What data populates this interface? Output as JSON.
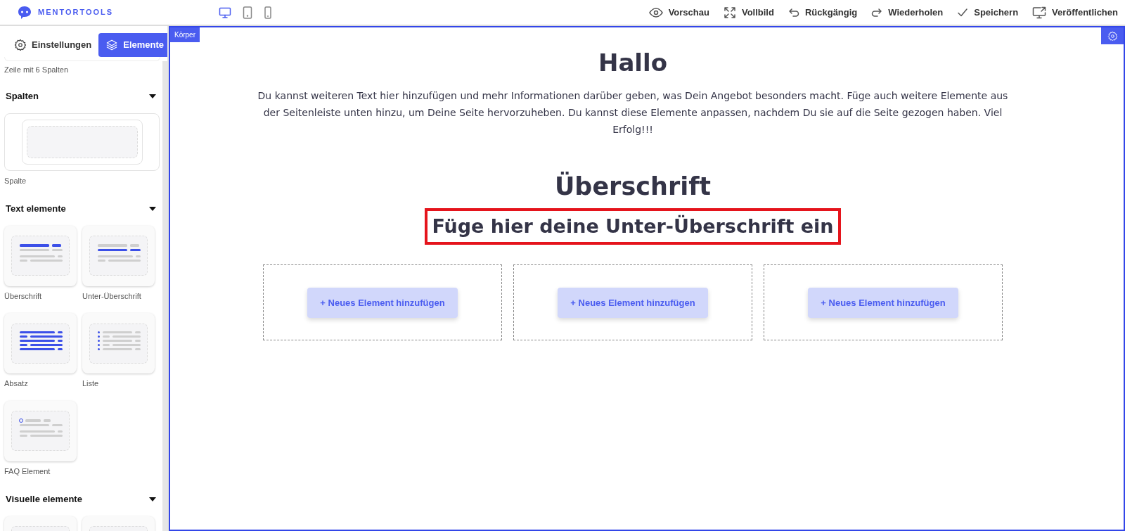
{
  "logo": {
    "text": "MENTORTOOLS"
  },
  "devices": [
    {
      "kind": "desktop",
      "selected": true
    },
    {
      "kind": "tablet",
      "selected": false
    },
    {
      "kind": "phone",
      "selected": false
    }
  ],
  "actions": [
    {
      "kind": "eye",
      "label": "Vorschau"
    },
    {
      "kind": "expand",
      "label": "Vollbild"
    },
    {
      "kind": "undo",
      "label": "Rückgängig"
    },
    {
      "kind": "redo",
      "label": "Wiederholen"
    },
    {
      "kind": "check",
      "label": "Speichern"
    },
    {
      "kind": "monitor",
      "label": "Veröffentlichen"
    }
  ],
  "sidebar": {
    "tabs": [
      {
        "kind": "gear",
        "label": "Einstellungen",
        "selected": false
      },
      {
        "kind": "layers",
        "label": "Elemente",
        "selected": true
      }
    ],
    "cut_item_label": "Zeile mit 6 Spalten",
    "sections": [
      {
        "title": "Spalten",
        "expanded": true,
        "items": [
          {
            "kind": "column",
            "label": "Spalte"
          }
        ]
      },
      {
        "title": "Text elemente",
        "expanded": true,
        "items": [
          {
            "kind": "heading",
            "label": "Überschrift"
          },
          {
            "kind": "subheading",
            "label": "Unter-Überschrift"
          },
          {
            "kind": "paragraph",
            "label": "Absatz"
          },
          {
            "kind": "list",
            "label": "Liste"
          },
          {
            "kind": "faq",
            "label": "FAQ Element"
          }
        ]
      },
      {
        "title": "Visuelle elemente",
        "expanded": true,
        "items": [
          {
            "kind": "blank"
          },
          {
            "kind": "blank"
          }
        ]
      }
    ]
  },
  "canvas": {
    "body_tag": "Körper",
    "title": "Hallo",
    "paragraph": "Du kannst weiteren Text hier hinzufügen und mehr Informationen darüber geben, was Dein Angebot besonders macht. Füge auch weitere Elemente aus der Seitenleiste unten hinzu, um Deine Seite hervorzuheben. Du kannst diese Elemente anpassen, nachdem Du sie auf die Seite gezogen haben. Viel Erfolg!!!",
    "heading": "Überschrift",
    "subheading": {
      "text": "Füge hier deine Unter-Überschrift ein",
      "highlighted": true
    },
    "columns": [
      {
        "button": "+ Neues Element hinzufügen"
      },
      {
        "button": "+ Neues Element hinzufügen"
      },
      {
        "button": "+ Neues Element hinzufügen"
      }
    ]
  }
}
